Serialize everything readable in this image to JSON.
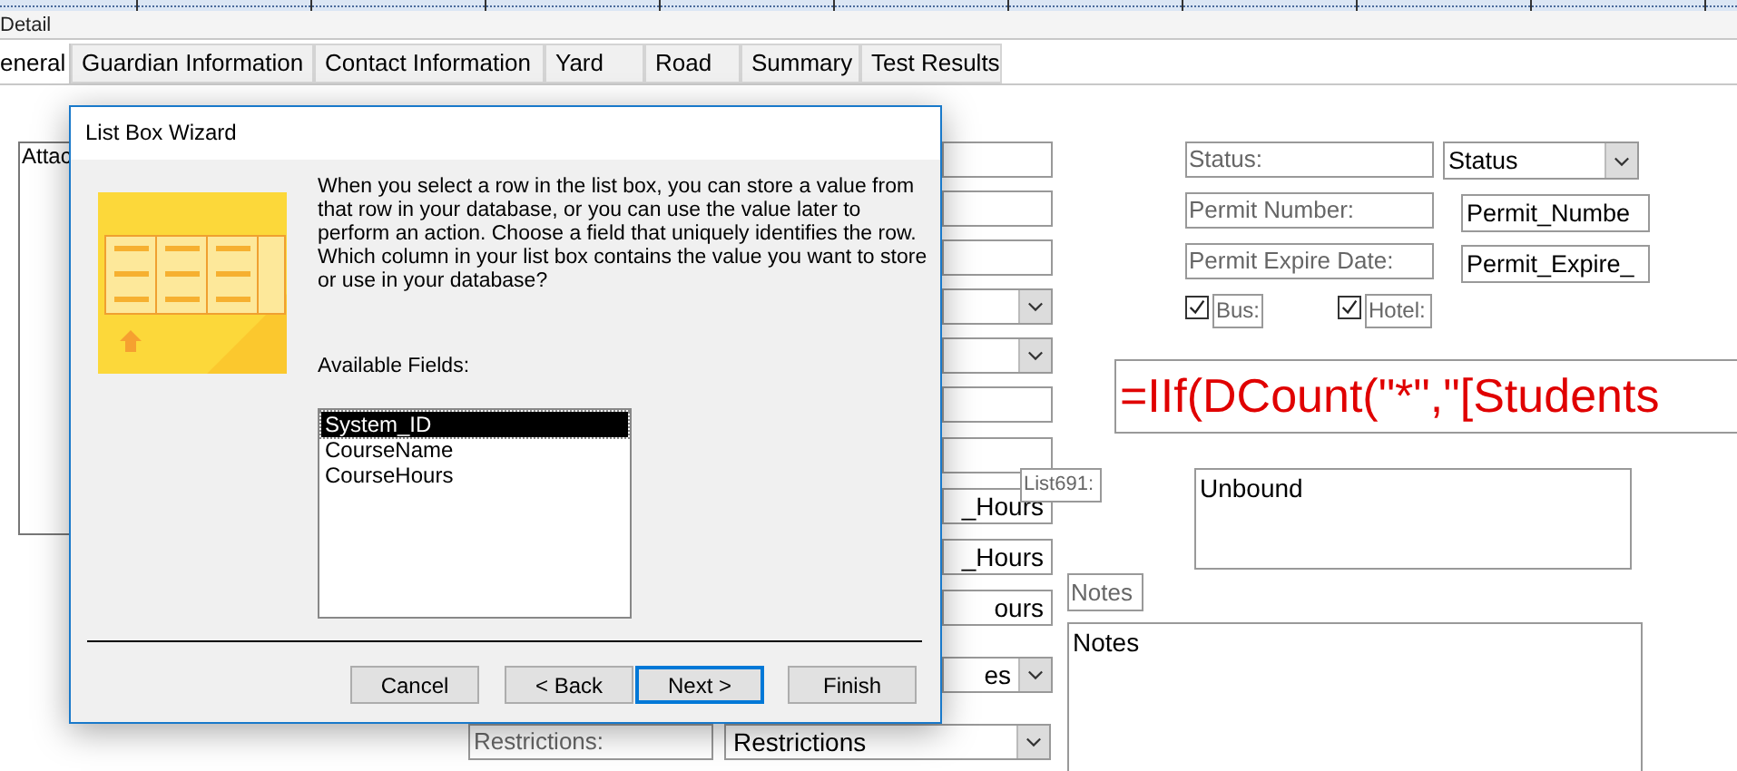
{
  "section": {
    "title": "Detail"
  },
  "tabs": [
    {
      "label": "eneral",
      "selected": true
    },
    {
      "label": "Guardian Information",
      "selected": false
    },
    {
      "label": "Contact Information",
      "selected": false
    },
    {
      "label": "Yard",
      "selected": false
    },
    {
      "label": "Road",
      "selected": false
    },
    {
      "label": "Summary",
      "selected": false
    },
    {
      "label": "Test Results",
      "selected": false
    }
  ],
  "attachment_box": {
    "text": "Attac"
  },
  "middle_fields": [
    {
      "kind": "textbox"
    },
    {
      "kind": "textbox"
    },
    {
      "kind": "textbox"
    },
    {
      "kind": "combo"
    },
    {
      "kind": "combo"
    },
    {
      "kind": "textbox"
    },
    {
      "kind": "textbox"
    },
    {
      "kind": "textbox",
      "value": "_Hours"
    },
    {
      "kind": "textbox",
      "value": "_Hours"
    },
    {
      "kind": "textbox",
      "value": "ours"
    },
    {
      "kind": "combo",
      "value": "es"
    },
    {
      "kind": "combo",
      "value": "Restrictions",
      "label": "Restrictions:"
    }
  ],
  "right_fields": [
    {
      "label": "Status:",
      "kind": "combo",
      "value": "Status"
    },
    {
      "label": "Permit Number:",
      "kind": "textbox",
      "value": "Permit_Numbe"
    },
    {
      "label": "Permit Expire Date:",
      "kind": "textbox",
      "value": "Permit_Expire_"
    }
  ],
  "checkboxes": [
    {
      "label": "Bus:",
      "checked": true
    },
    {
      "label": "Hotel:",
      "checked": true
    }
  ],
  "formula": {
    "text": "=IIf(DCount(\"*\",\"[Students"
  },
  "list_control": {
    "label": "List691:",
    "value": "Unbound"
  },
  "notes": {
    "label": "Notes",
    "value": "Notes"
  },
  "dialog": {
    "title": "List Box Wizard",
    "instructions": "When you select a row in the list box, you can store a value from that row in your database, or you can use the value later to perform an action.  Choose a field that uniquely identifies the row. Which column in your list box contains the value you want to store or use in your database?",
    "fields_label": "Available Fields:",
    "fields": [
      {
        "label": "System_ID",
        "selected": true
      },
      {
        "label": "CourseName",
        "selected": false
      },
      {
        "label": "CourseHours",
        "selected": false
      }
    ],
    "buttons": [
      {
        "label": "Cancel",
        "default": false
      },
      {
        "label": "< Back",
        "default": false
      },
      {
        "label": "Next >",
        "default": true
      },
      {
        "label": "Finish",
        "default": false
      }
    ]
  }
}
